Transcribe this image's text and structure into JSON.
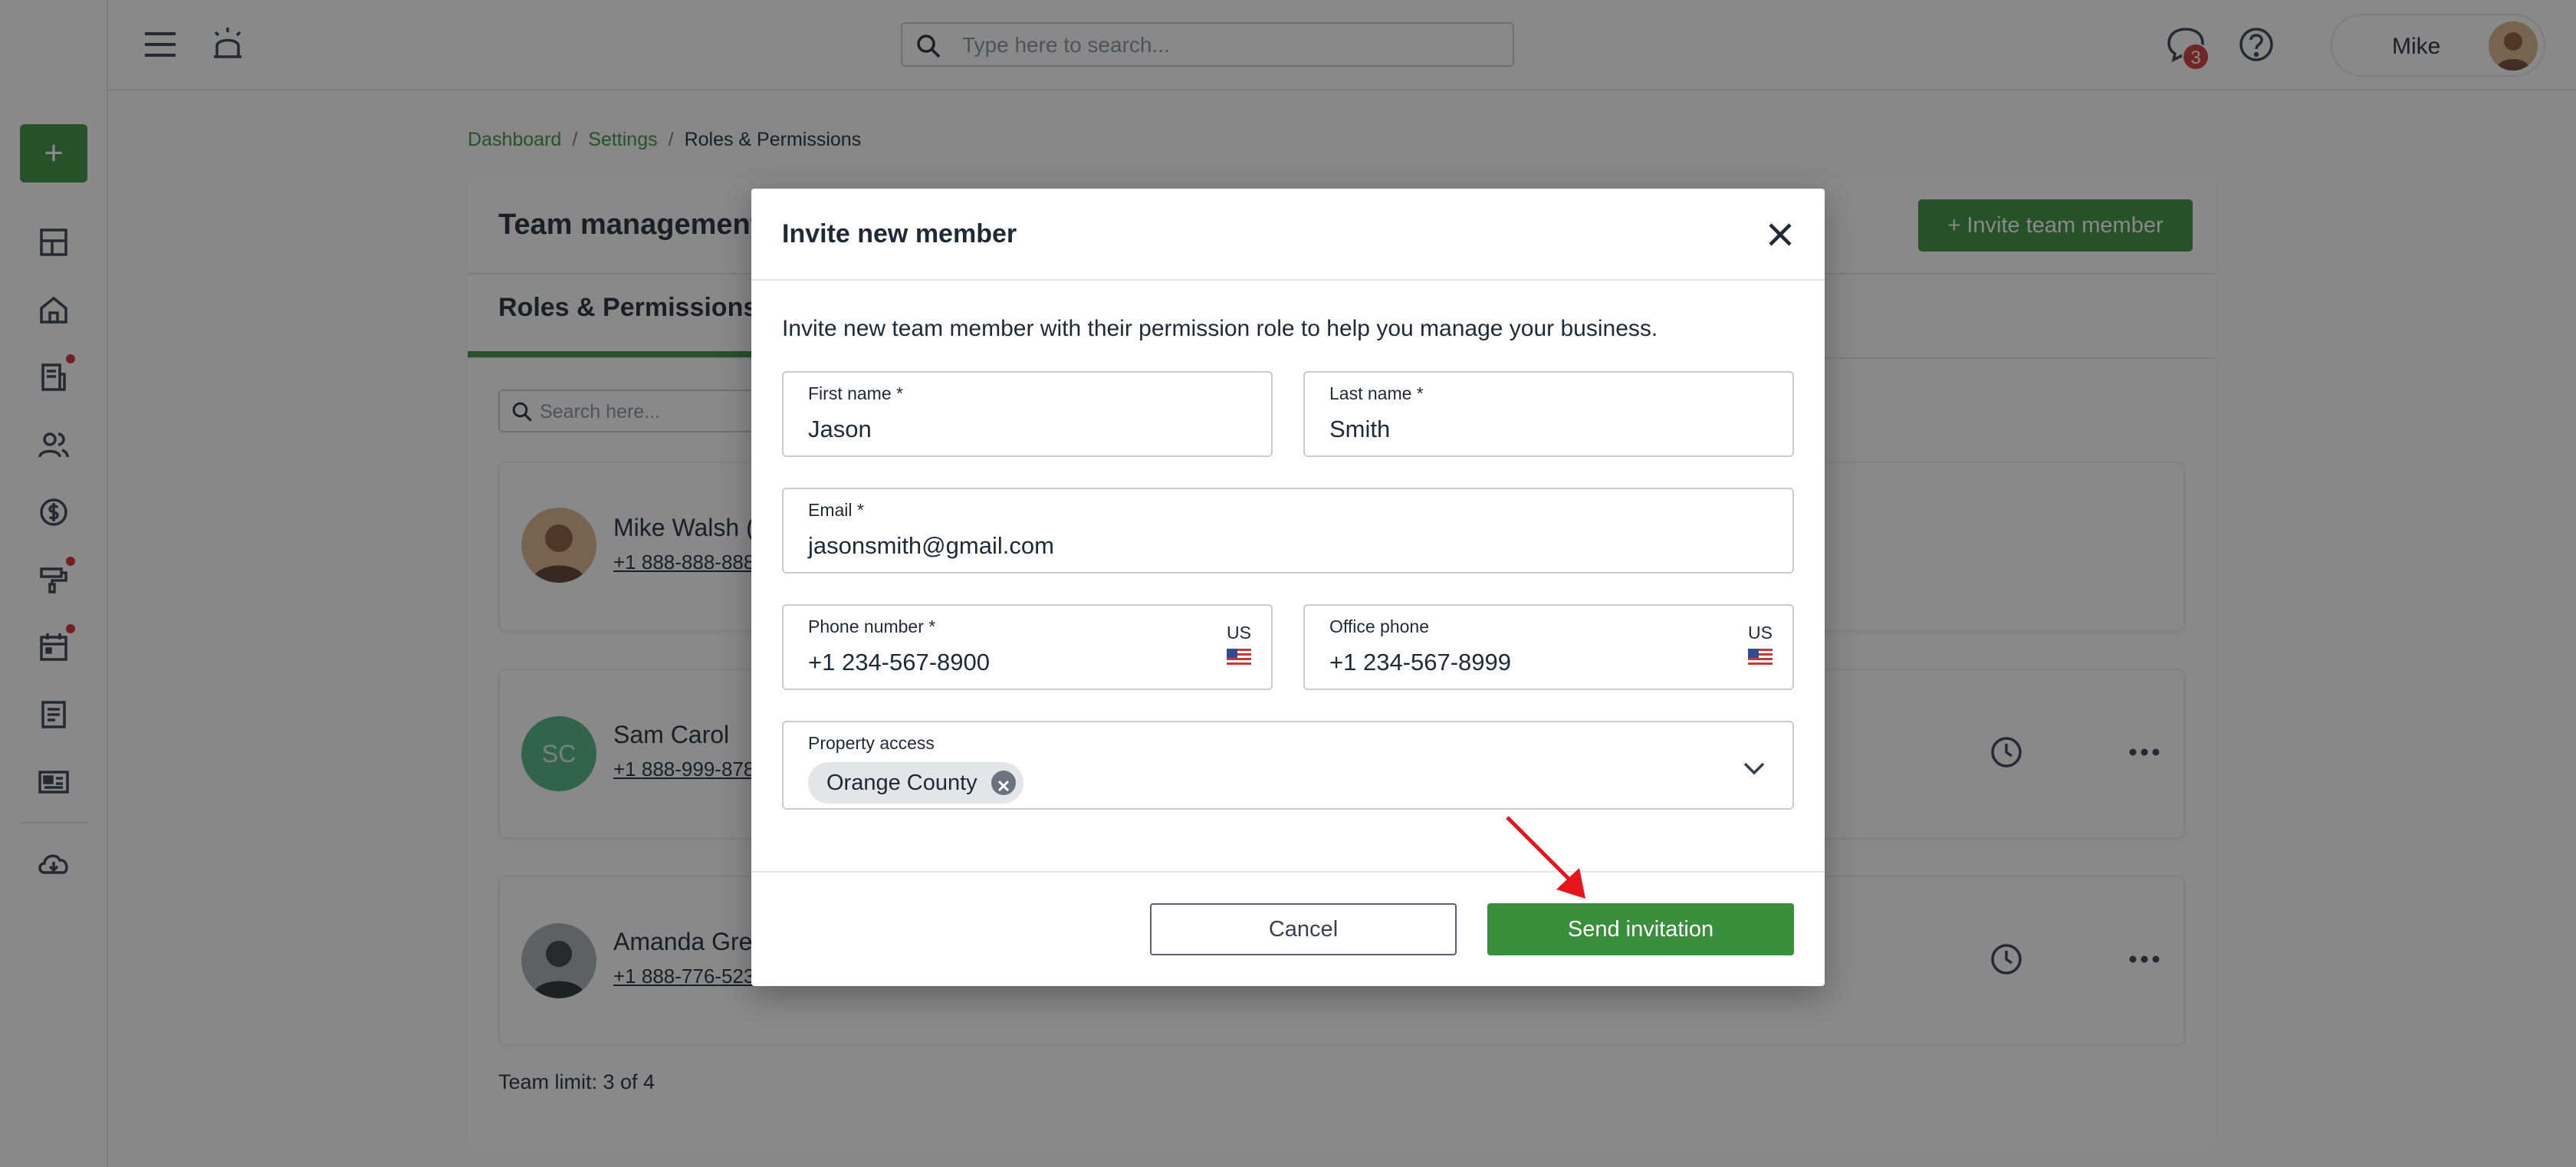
{
  "topbar": {
    "search_placeholder": "Type here to search...",
    "notifications_count": "3",
    "user_name": "Mike"
  },
  "breadcrumb": {
    "items": [
      "Dashboard",
      "Settings",
      "Roles & Permissions"
    ],
    "separator": "/"
  },
  "page": {
    "title": "Team management",
    "invite_button": "+ Invite team member",
    "active_tab": "Roles & Permissions",
    "search_placeholder": "Search here...",
    "members": [
      {
        "name": "Mike Walsh (",
        "phone": "+1 888-888-888",
        "initials": ""
      },
      {
        "name": "Sam Carol",
        "phone": "+1 888-999-878",
        "initials": "SC"
      },
      {
        "name": "Amanda Gre",
        "phone": "+1 888-776-523",
        "initials": ""
      }
    ],
    "team_limit": "Team limit: 3 of 4"
  },
  "modal": {
    "title": "Invite new member",
    "description": "Invite new team member with their permission role to help you manage your business.",
    "first_name": {
      "label": "First name *",
      "value": "Jason"
    },
    "last_name": {
      "label": "Last name *",
      "value": "Smith"
    },
    "email": {
      "label": "Email *",
      "value": "jasonsmith@gmail.com"
    },
    "phone": {
      "label": "Phone number *",
      "value": "+1 234-567-8900",
      "country": "US"
    },
    "office_phone": {
      "label": "Office phone",
      "value": "+1 234-567-8999",
      "country": "US"
    },
    "property_access": {
      "label": "Property access",
      "selected": [
        "Orange County"
      ]
    },
    "cancel_label": "Cancel",
    "send_label": "Send invitation"
  },
  "colors": {
    "brand_green": "#3a8f3c",
    "badge_red": "#c8383a",
    "annotation_arrow": "#e8141b"
  }
}
